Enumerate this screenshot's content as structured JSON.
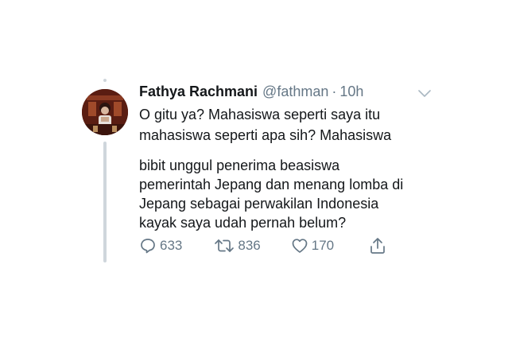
{
  "tweet": {
    "author_name": "Fathya Rachmani",
    "handle": "@fathman",
    "separator": "·",
    "time": "10h",
    "lines_1": [
      "O gitu ya? Mahasiswa seperti saya itu",
      "mahasiswa seperti apa sih? Mahasiswa"
    ],
    "lines_2": [
      "bibit unggul penerima beasiswa",
      "pemerintah Jepang dan menang lomba di",
      "Jepang sebagai perwakilan Indonesia",
      "kayak saya udah pernah belum?"
    ],
    "actions": {
      "reply_count": "633",
      "retweet_count": "836",
      "like_count": "170"
    }
  },
  "colors": {
    "text": "#14171a",
    "secondary": "#657786",
    "thread_line": "#cfd6dc"
  },
  "icons": [
    "reply-icon",
    "retweet-icon",
    "like-icon",
    "share-icon",
    "chevron-down-icon"
  ]
}
